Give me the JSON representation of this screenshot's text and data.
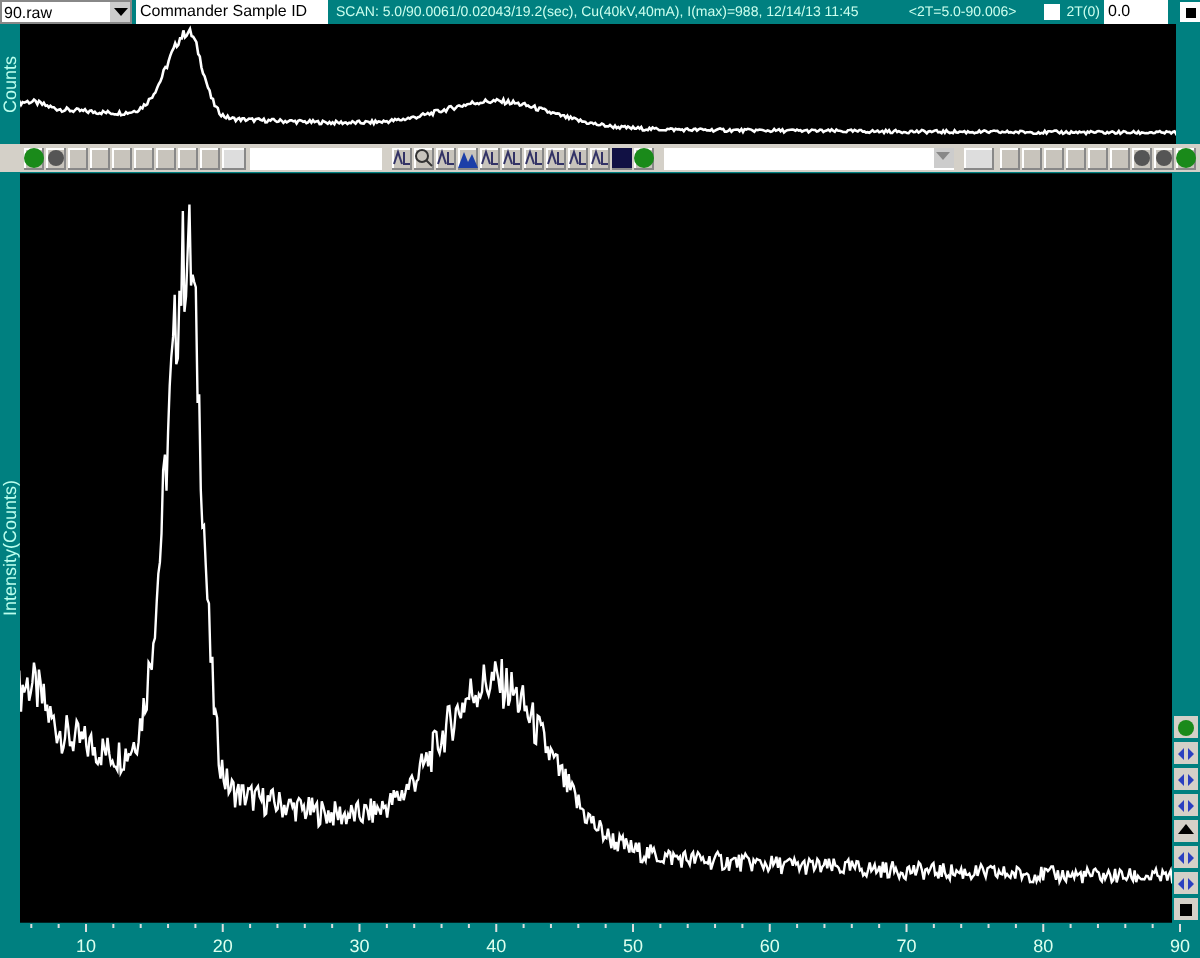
{
  "file_select": {
    "value": "90.raw"
  },
  "sample_id": {
    "value": "Commander Sample ID"
  },
  "scan_info": "SCAN: 5.0/90.0061/0.02043/19.2(sec), Cu(40kV,40mA), I(max)=988, 12/14/13 11:45",
  "range_info": "<2T=5.0-90.006>",
  "two_theta_zero": {
    "label": "2T(0)",
    "checked": false,
    "value": "0.0"
  },
  "overview": {
    "ylabel": "Counts"
  },
  "main_plot": {
    "ylabel": "Intensity(Counts)"
  },
  "x_axis": {
    "ticks": [
      "10",
      "20",
      "30",
      "40",
      "50",
      "60",
      "70",
      "80",
      "90"
    ]
  }
}
